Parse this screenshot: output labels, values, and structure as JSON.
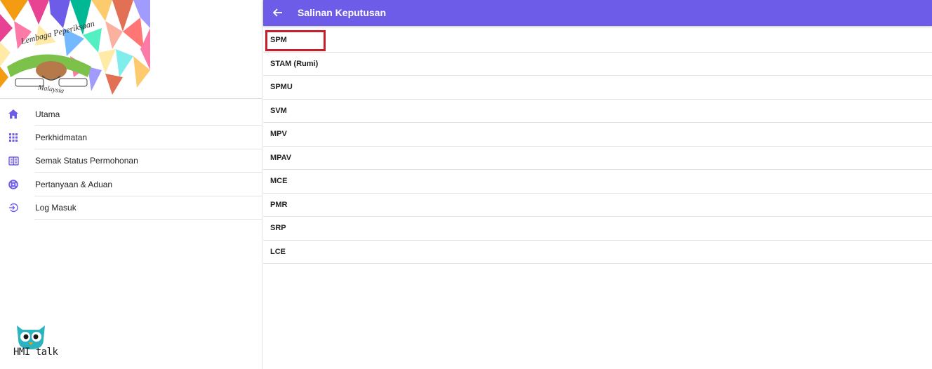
{
  "sidebar": {
    "logo": {
      "top_text": "Lembaga Peperiksaan",
      "bottom_text": "Malaysia"
    },
    "items": [
      {
        "label": "Utama",
        "icon": "home-icon"
      },
      {
        "label": "Perkhidmatan",
        "icon": "apps-grid-icon"
      },
      {
        "label": "Semak Status Permohonan",
        "icon": "newspaper-icon"
      },
      {
        "label": "Pertanyaan & Aduan",
        "icon": "lifebuoy-icon"
      },
      {
        "label": "Log Masuk",
        "icon": "login-icon"
      }
    ],
    "watermark": "HMI talk"
  },
  "header": {
    "title": "Salinan Keputusan",
    "back_icon": "arrow-left-icon"
  },
  "colors": {
    "accent": "#6c5ce7",
    "highlight": "#c8202a"
  },
  "list": {
    "items": [
      "SPM",
      "STAM (Rumi)",
      "SPMU",
      "SVM",
      "MPV",
      "MPAV",
      "MCE",
      "PMR",
      "SRP",
      "LCE"
    ]
  }
}
